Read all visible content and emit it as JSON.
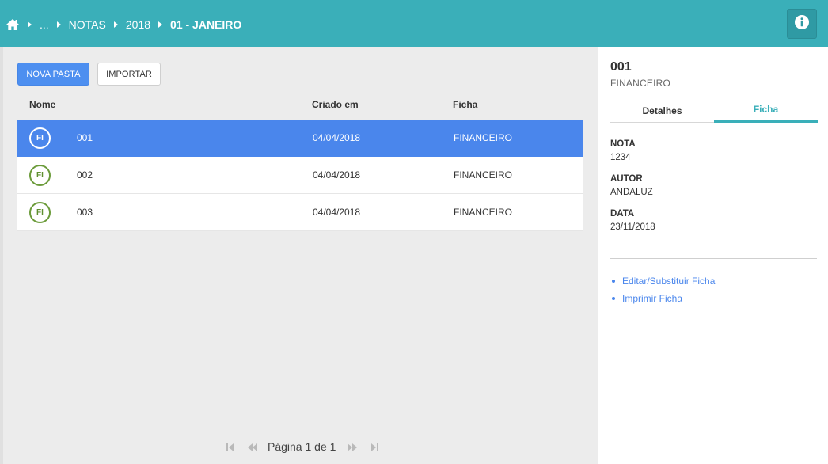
{
  "breadcrumb": {
    "ellipsis": "...",
    "items": [
      "NOTAS",
      "2018"
    ],
    "current": "01 - JANEIRO"
  },
  "toolbar": {
    "new_folder_label": "NOVA PASTA",
    "import_label": "IMPORTAR"
  },
  "table": {
    "columns": {
      "name": "Nome",
      "created": "Criado em",
      "ficha": "Ficha"
    },
    "rows": [
      {
        "badge": "FI",
        "name": "001",
        "created": "04/04/2018",
        "ficha": "FINANCEIRO",
        "selected": true
      },
      {
        "badge": "FI",
        "name": "002",
        "created": "04/04/2018",
        "ficha": "FINANCEIRO",
        "selected": false
      },
      {
        "badge": "FI",
        "name": "003",
        "created": "04/04/2018",
        "ficha": "FINANCEIRO",
        "selected": false
      }
    ]
  },
  "pager": {
    "text": "Página 1 de 1"
  },
  "details": {
    "title": "001",
    "subtitle": "FINANCEIRO",
    "tabs": [
      "Detalhes",
      "Ficha"
    ],
    "active_tab": "Ficha",
    "fields": [
      {
        "label": "NOTA",
        "value": "1234"
      },
      {
        "label": "AUTOR",
        "value": "ANDALUZ"
      },
      {
        "label": "DATA",
        "value": "23/11/2018"
      }
    ],
    "links": [
      "Editar/Substituir Ficha",
      "Imprimir Ficha"
    ]
  },
  "colors": {
    "header": "#3aafb9",
    "accent_blue": "#4a86ec",
    "badge_green": "#6b9b3a"
  },
  "icons": {
    "home": "home-icon",
    "info": "info-icon",
    "first": "first-page-icon",
    "prev": "previous-page-icon",
    "next": "next-page-icon",
    "last": "last-page-icon"
  }
}
